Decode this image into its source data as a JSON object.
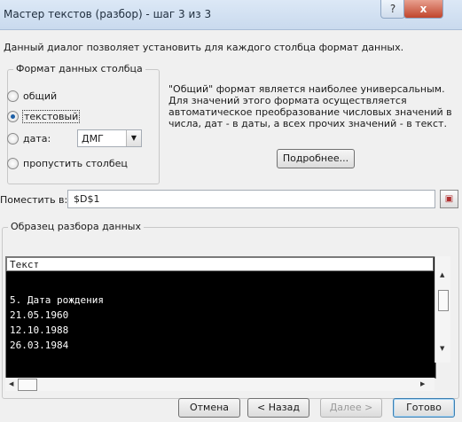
{
  "window": {
    "title": "Мастер текстов (разбор) - шаг 3 из 3",
    "help_glyph": "?",
    "close_glyph": "x"
  },
  "description": "Данный диалог позволяет установить для каждого столбца формат данных.",
  "column_format": {
    "group_title": "Формат данных столбца",
    "options": [
      {
        "label": "общий",
        "selected": false
      },
      {
        "label": "текстовый",
        "selected": true
      },
      {
        "label": "дата:",
        "selected": false
      },
      {
        "label": "пропустить столбец",
        "selected": false
      }
    ],
    "date_format": "ДМГ"
  },
  "info_text": "\"Общий\" формат является наиболее универсальным. Для значений этого формата осуществляется автоматическое преобразование числовых значений в числа, дат - в даты, а всех прочих значений - в текст.",
  "details_button": "Подробнее...",
  "destination": {
    "label": "Поместить в:",
    "value": "$D$1"
  },
  "preview": {
    "group_title": "Образец разбора данных",
    "column_header": "Текст",
    "lines": [
      "5. Дата рождения",
      "21.05.1960",
      "12.10.1988",
      "26.03.1984"
    ]
  },
  "buttons": {
    "cancel": "Отмена",
    "back": "< Назад",
    "next": "Далее >",
    "finish": "Готово"
  }
}
